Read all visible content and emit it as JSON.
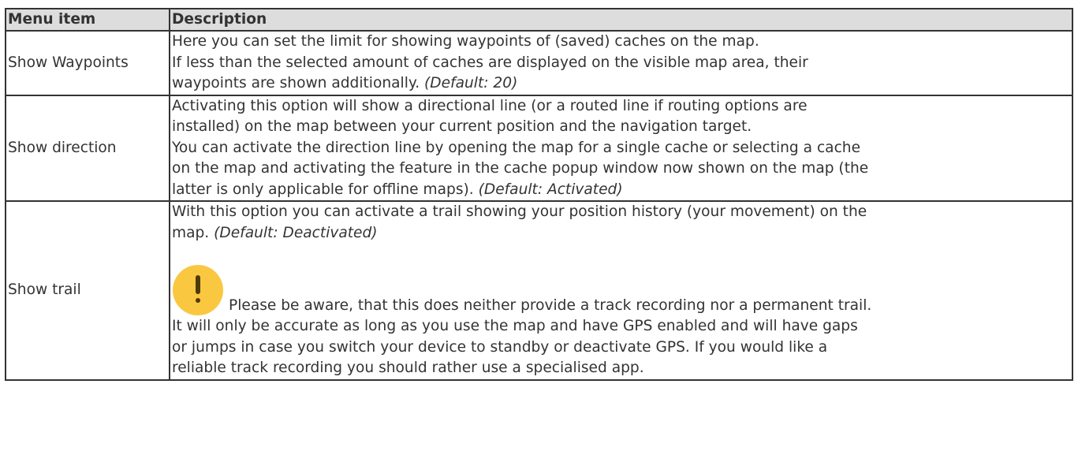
{
  "table": {
    "headers": {
      "item": "Menu item",
      "description": "Description"
    },
    "rows": [
      {
        "item": "Show Waypoints",
        "lines": [
          "Here you can set the limit for showing waypoints of (saved) caches on the map.",
          "If less than the selected amount of caches are displayed on the visible map area, their",
          "waypoints are shown additionally."
        ],
        "default": "(Default: 20)"
      },
      {
        "item": "Show direction",
        "lines": [
          "Activating this option will show a directional line (or a routed line if routing options are",
          "installed) on the map between your current position and the navigation target.",
          "You can activate the direction line by opening the map for a single cache or selecting a cache",
          "on the map and activating the feature in the cache popup window now shown on the map (the",
          "latter is only applicable for offline maps)."
        ],
        "default": "(Default: Activated)"
      },
      {
        "item": "Show trail",
        "lines": [
          "With this option you can activate a trail showing your position history (your movement) on the",
          "map."
        ],
        "default": "(Default: Deactivated)",
        "warning": {
          "icon": "warning-icon",
          "icon_color": "#fac741",
          "lines": [
            "Please be aware, that this does neither provide a track recording nor a permanent trail.",
            "It will only be accurate as long as you use the map and have GPS enabled and will have gaps",
            "or jumps in case you switch your device to standby or deactivate GPS. If you would like a",
            "reliable track recording you should rather use a specialised app."
          ]
        }
      }
    ]
  },
  "colors": {
    "header_bg": "#dddddd",
    "border": "#333333",
    "text": "#333333"
  }
}
